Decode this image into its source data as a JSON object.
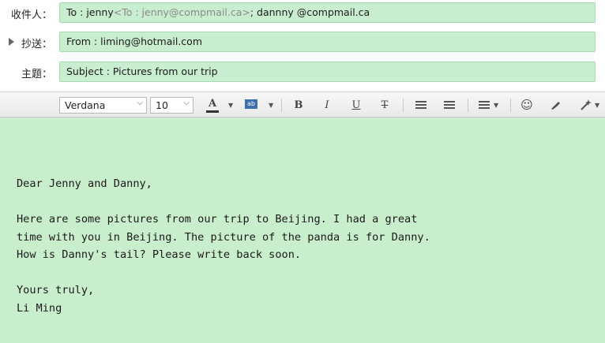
{
  "header": {
    "to": {
      "label": "收件人：",
      "prefix": "To : jenny",
      "dim_address": "<To : jenny@compmail.ca>",
      "separator": "; ",
      "second_address": "dannny @compmail.ca"
    },
    "cc": {
      "label": "抄送：",
      "value": "From : liming@hotmail.com"
    },
    "subject": {
      "label": "主题：",
      "value": "Subject : Pictures from our trip"
    }
  },
  "toolbar": {
    "font_family": "Verdana",
    "font_size": "10",
    "bold": "B",
    "italic": "I",
    "underline": "U",
    "strikethrough": "T",
    "font_color_glyph": "A",
    "highlight_glyph": "ab",
    "emoji_glyph": "☺"
  },
  "message": {
    "greeting": "Dear Jenny and Danny,",
    "line1": "Here are some pictures from our trip to Beijing. I had a great",
    "line2": "time with you in Beijing. The picture of the panda is for Danny.",
    "line3": "How is Danny's tail? Please write back soon.",
    "closing": "Yours truly,",
    "signature": "Li Ming"
  },
  "colors": {
    "field_bg": "#c9eecf",
    "body_bg": "#c8eecb",
    "toolbar_bg": "#efefef"
  }
}
